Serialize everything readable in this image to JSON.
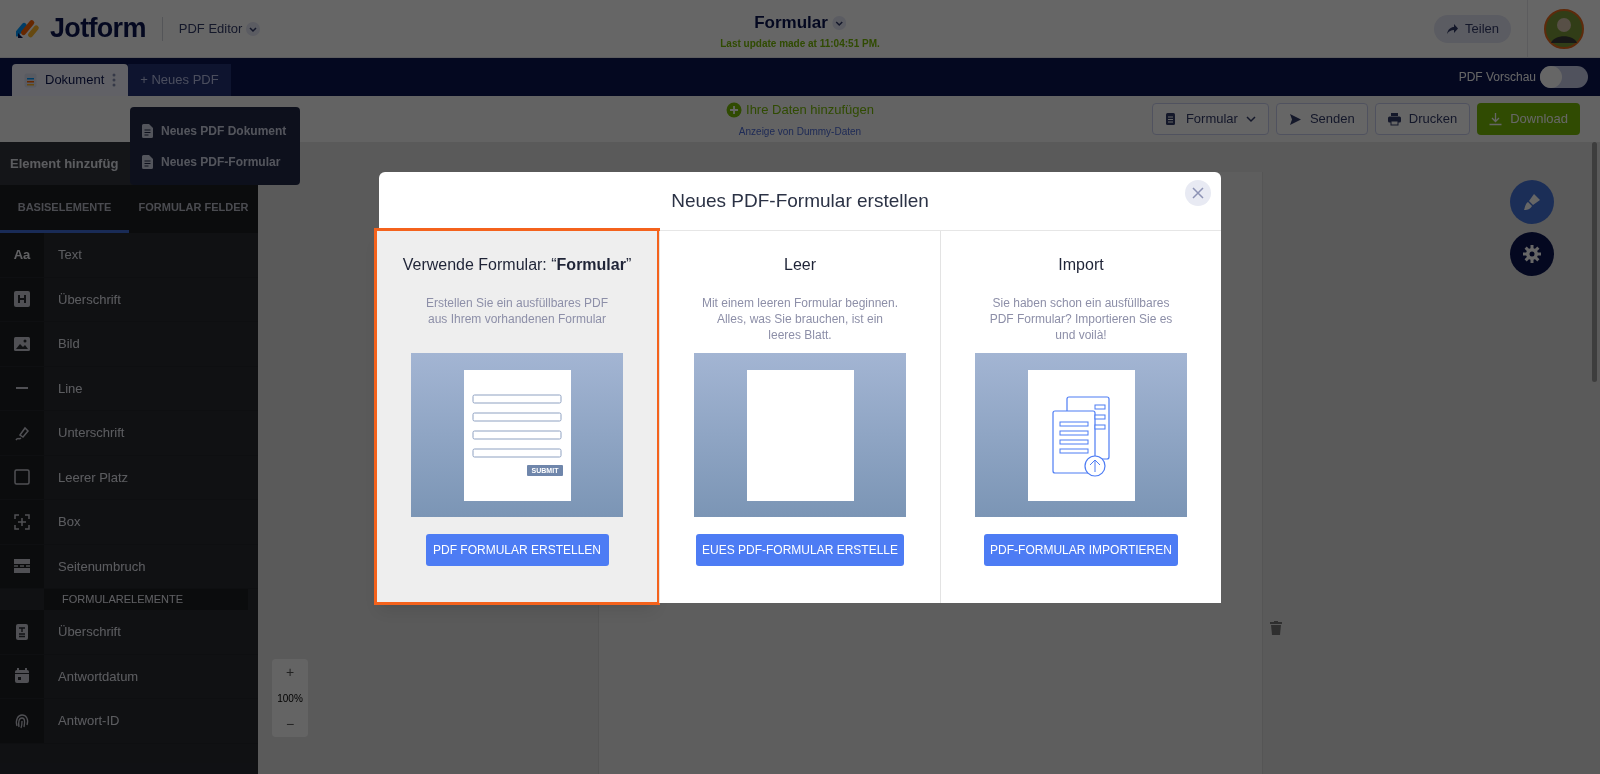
{
  "header": {
    "logo": "Jotform",
    "product": "PDF Editor",
    "title": "Formular",
    "last_update": "Last update made at 11:04:51 PM.",
    "share": "Teilen"
  },
  "tabs": [
    {
      "label": "Dokument",
      "selected": true
    },
    {
      "label": "+ Neues PDF",
      "selected": false
    }
  ],
  "pdf_preview": {
    "label": "PDF Vorschau",
    "on": false
  },
  "new_pdf_menu": [
    "Neues PDF Dokument",
    "Neues PDF-Formular"
  ],
  "data_bar": {
    "add": "Ihre Daten hinzufügen",
    "dummy": "Anzeige von Dummy-Daten"
  },
  "toolbar": [
    {
      "kind": "dropdown",
      "label": "Formular"
    },
    {
      "kind": "send",
      "label": "Senden"
    },
    {
      "kind": "print",
      "label": "Drucken"
    },
    {
      "kind": "download",
      "label": "Download"
    }
  ],
  "sidebar": {
    "title": "Element hinzufüg",
    "tabs": [
      {
        "label": "BASISELEMENTE",
        "selected": true
      },
      {
        "label": "FORMULAR FELDER",
        "selected": false
      }
    ],
    "items": [
      {
        "kind": "text",
        "glyph": "Aa",
        "label": "Text"
      },
      {
        "kind": "heading",
        "label": "Überschrift"
      },
      {
        "kind": "image",
        "label": "Bild"
      },
      {
        "kind": "line",
        "label": "Line"
      },
      {
        "kind": "signature",
        "label": "Unterschrift"
      },
      {
        "kind": "space",
        "label": "Leerer Platz"
      },
      {
        "kind": "box",
        "label": "Box"
      },
      {
        "kind": "pagebreak",
        "label": "Seitenumbruch"
      },
      {
        "kind": "section",
        "label": "FORMULARELEMENTE"
      },
      {
        "kind": "formheading",
        "label": "Überschrift"
      },
      {
        "kind": "date",
        "label": "Antwortdatum"
      },
      {
        "kind": "fingerprint",
        "label": "Antwort-ID"
      }
    ]
  },
  "zoom": {
    "plus": "+",
    "level": "100%",
    "minus": "−"
  },
  "modal": {
    "title": "Neues PDF-Formular erstellen",
    "options": [
      {
        "kind": "form",
        "selected": true,
        "title": "Verwende Formular: “**Formular**”",
        "description": "Erstellen Sie ein ausfüllbares PDF aus Ihrem vorhandenen Formular",
        "submit": "SUBMIT",
        "button": "PDF FORMULAR ERSTELLEN"
      },
      {
        "kind": "blank",
        "selected": false,
        "title": "Leer",
        "description": "Mit einem leeren Formular beginnen. Alles, was Sie brauchen, ist ein leeres Blatt.",
        "button": "EUES PDF-FORMULAR ERSTELLE"
      },
      {
        "kind": "import",
        "selected": false,
        "title": "Import",
        "description": "Sie haben schon ein ausfüllbares PDF Formular? Importieren Sie es und voilà!",
        "button": "PDF-FORMULAR IMPORTIEREN"
      }
    ]
  }
}
